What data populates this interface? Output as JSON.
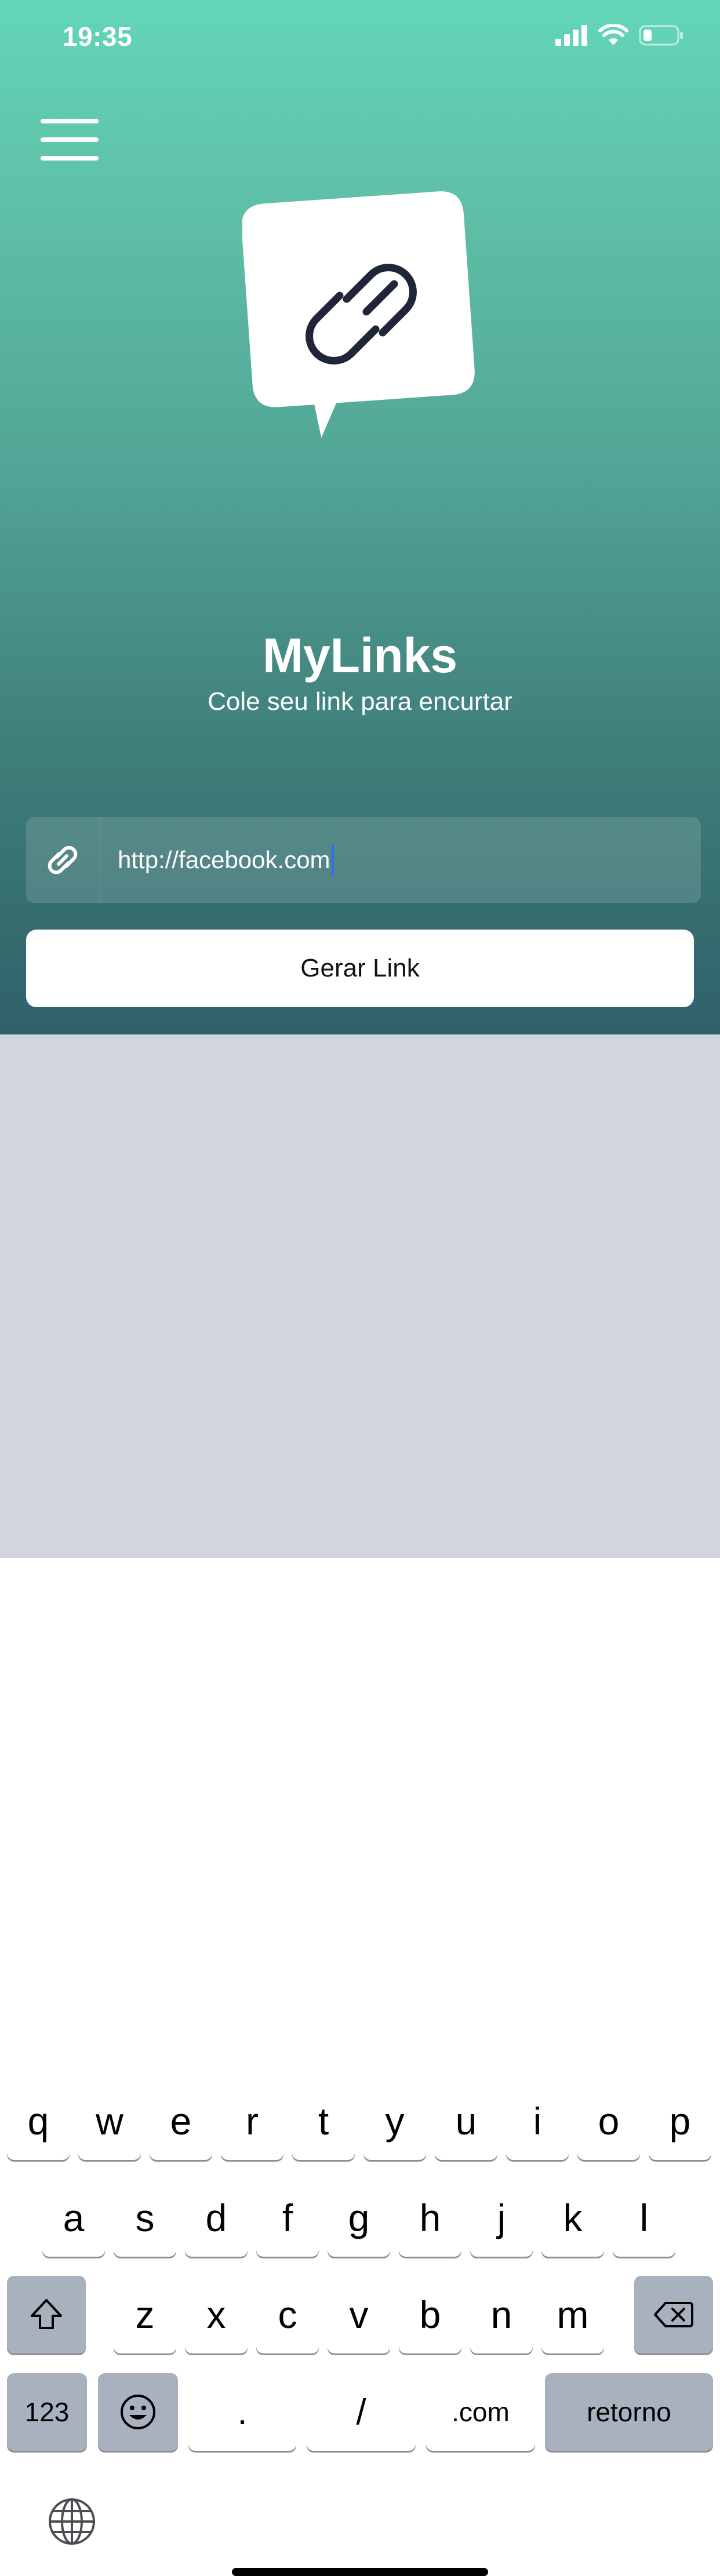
{
  "status_bar": {
    "time": "19:35"
  },
  "app": {
    "title": "MyLinks",
    "subtitle": "Cole seu link para encurtar",
    "input_value": "http://facebook.com",
    "button_label": "Gerar Link"
  },
  "keyboard": {
    "row1": [
      "q",
      "w",
      "e",
      "r",
      "t",
      "y",
      "u",
      "i",
      "o",
      "p"
    ],
    "row2": [
      "a",
      "s",
      "d",
      "f",
      "g",
      "h",
      "j",
      "k",
      "l"
    ],
    "row3": [
      "z",
      "x",
      "c",
      "v",
      "b",
      "n",
      "m"
    ],
    "bottom": {
      "numbers": "123",
      "dot": ".",
      "slash": "/",
      "dotcom": ".com",
      "return": "retorno"
    }
  },
  "colors": {
    "accent_top": "#63d6b9",
    "accent_bottom": "#2f6169",
    "caret": "#2f6cf0"
  }
}
